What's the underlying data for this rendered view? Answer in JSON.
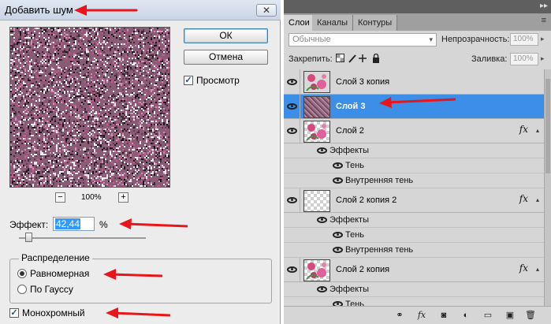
{
  "dialog": {
    "title": "Добавить шум",
    "close_glyph": "✕",
    "ok_label": "ОК",
    "cancel_label": "Отмена",
    "preview_label": "Просмотр",
    "preview_checked": true,
    "zoom_out": "−",
    "zoom_in": "+",
    "zoom_level": "100%",
    "effect_label": "Эффект:",
    "effect_value": "42,44",
    "effect_unit": "%",
    "distribution_label": "Распределение",
    "distribution_options": [
      "Равномерная",
      "По Гауссу"
    ],
    "distribution_selected": "Равномерная",
    "monochrome_label": "Монохромный",
    "monochrome_checked": true,
    "check_glyph": "✓"
  },
  "layers_panel": {
    "tabs": [
      "Слои",
      "Каналы",
      "Контуры"
    ],
    "active_tab": "Слои",
    "menu_glyph": "≡",
    "collapse_glyph": "▸▸",
    "blend_mode": "Обычные",
    "opacity_label": "Непрозрачность:",
    "opacity_value": "100%",
    "lock_label": "Закрепить:",
    "fill_label": "Заливка:",
    "fill_value": "100%",
    "layers": [
      {
        "name": "Слой 3 копия",
        "selected": false,
        "has_fx": false
      },
      {
        "name": "Слой 3",
        "selected": true,
        "has_fx": false
      },
      {
        "name": "Слой 2",
        "selected": false,
        "has_fx": true,
        "effects_label": "Эффекты",
        "effects": [
          "Тень",
          "Внутренняя тень"
        ]
      },
      {
        "name": "Слой 2 копия 2",
        "selected": false,
        "has_fx": true,
        "effects_label": "Эффекты",
        "effects": [
          "Тень",
          "Внутренняя тень"
        ]
      },
      {
        "name": "Слой 2 копия",
        "selected": false,
        "has_fx": true,
        "effects_label": "Эффекты",
        "effects": [
          "Тень"
        ]
      }
    ],
    "fx_glyph": "fx",
    "footer_icons": [
      "link-icon",
      "fx-icon",
      "mask-icon",
      "adjustment-icon",
      "group-folder-icon",
      "new-layer-icon",
      "trash-icon"
    ],
    "footer_glyphs": [
      "⚭",
      "fx",
      "◙",
      "◐",
      "▭",
      "▣",
      "🗑"
    ]
  },
  "colors": {
    "selection": "#3d8ee6",
    "annotation_arrow": "#e8161b",
    "noise_base": "#8a5b75"
  }
}
